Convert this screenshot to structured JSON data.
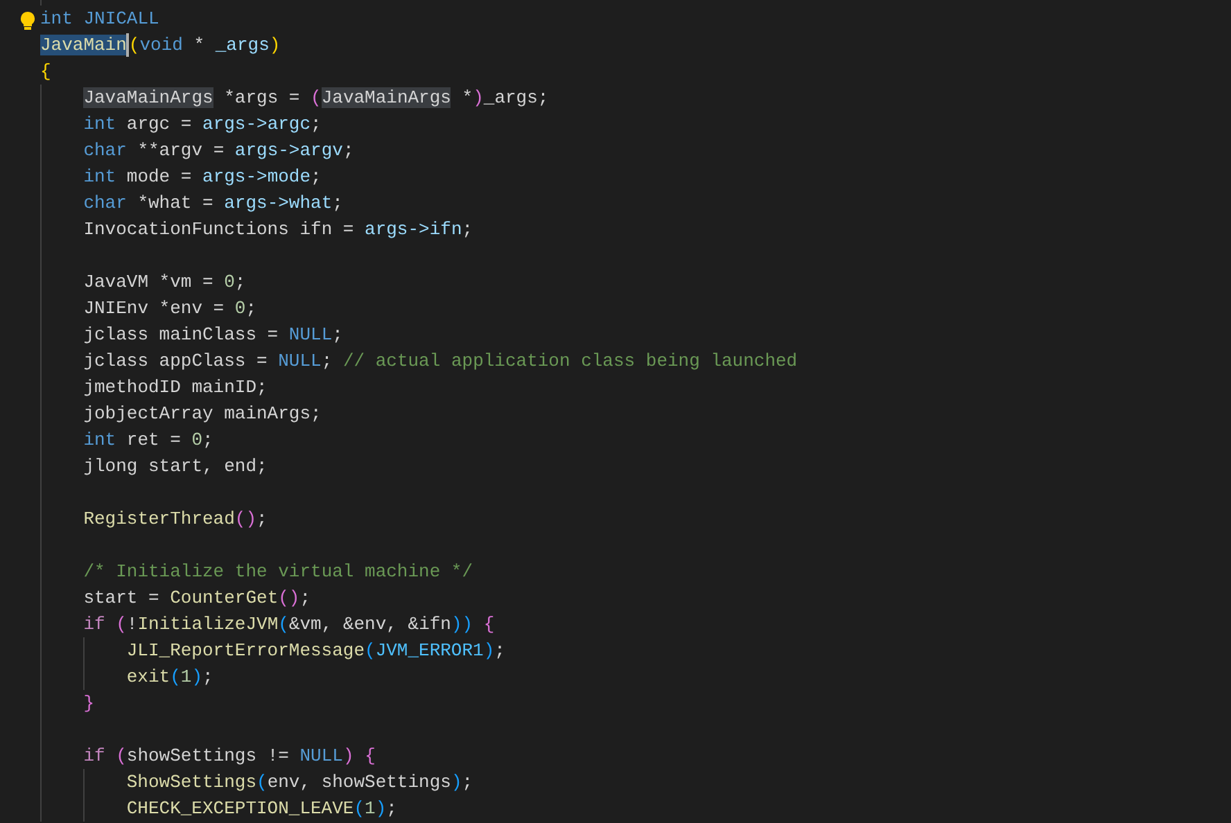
{
  "editor": {
    "lines": [
      {
        "kind": "blank"
      },
      {
        "kind": "code",
        "tokens": [
          {
            "text": "int ",
            "kind": "keyword"
          },
          {
            "text": "JNICALL",
            "kind": "macro"
          }
        ]
      },
      {
        "kind": "code",
        "tokens": [
          {
            "text": "JavaMain",
            "kind": "function",
            "selected": true
          },
          {
            "text": "(",
            "kind": "bracket1"
          },
          {
            "text": "void",
            "kind": "keyword"
          },
          {
            "text": " * ",
            "kind": "plain"
          },
          {
            "text": "_args",
            "kind": "member"
          },
          {
            "text": ")",
            "kind": "bracket1"
          }
        ]
      },
      {
        "kind": "code",
        "tokens": [
          {
            "text": "{",
            "kind": "bracket1"
          }
        ]
      },
      {
        "kind": "code",
        "tokens": [
          {
            "text": "    JavaMainArgs",
            "kind": "plain",
            "highlighted": true
          },
          {
            "text": " *args = ",
            "kind": "plain"
          },
          {
            "text": "(",
            "kind": "bracket2"
          },
          {
            "text": "JavaMainArgs",
            "kind": "plain",
            "highlighted": true
          },
          {
            "text": " *",
            "kind": "plain"
          },
          {
            "text": ")",
            "kind": "bracket2"
          },
          {
            "text": "_args;",
            "kind": "plain"
          }
        ]
      },
      {
        "kind": "code",
        "tokens": [
          {
            "text": "    int",
            "kind": "keyword"
          },
          {
            "text": " argc = ",
            "kind": "plain"
          },
          {
            "text": "args->argc",
            "kind": "member"
          },
          {
            "text": ";",
            "kind": "plain"
          }
        ]
      },
      {
        "kind": "code",
        "tokens": [
          {
            "text": "    char",
            "kind": "keyword"
          },
          {
            "text": " **argv = ",
            "kind": "plain"
          },
          {
            "text": "args->argv",
            "kind": "member"
          },
          {
            "text": ";",
            "kind": "plain"
          }
        ]
      },
      {
        "kind": "code",
        "tokens": [
          {
            "text": "    int",
            "kind": "keyword"
          },
          {
            "text": " mode = ",
            "kind": "plain"
          },
          {
            "text": "args->mode",
            "kind": "member"
          },
          {
            "text": ";",
            "kind": "plain"
          }
        ]
      },
      {
        "kind": "code",
        "tokens": [
          {
            "text": "    char",
            "kind": "keyword"
          },
          {
            "text": " *what = ",
            "kind": "plain"
          },
          {
            "text": "args->what",
            "kind": "member"
          },
          {
            "text": ";",
            "kind": "plain"
          }
        ]
      },
      {
        "kind": "code",
        "tokens": [
          {
            "text": "    InvocationFunctions ifn = ",
            "kind": "plain"
          },
          {
            "text": "args->ifn",
            "kind": "member"
          },
          {
            "text": ";",
            "kind": "plain"
          }
        ]
      },
      {
        "kind": "blank"
      },
      {
        "kind": "code",
        "tokens": [
          {
            "text": "    JavaVM *vm = ",
            "kind": "plain"
          },
          {
            "text": "0",
            "kind": "number"
          },
          {
            "text": ";",
            "kind": "plain"
          }
        ]
      },
      {
        "kind": "code",
        "tokens": [
          {
            "text": "    JNIEnv *env = ",
            "kind": "plain"
          },
          {
            "text": "0",
            "kind": "number"
          },
          {
            "text": ";",
            "kind": "plain"
          }
        ]
      },
      {
        "kind": "code",
        "tokens": [
          {
            "text": "    jclass mainClass = ",
            "kind": "plain"
          },
          {
            "text": "NULL",
            "kind": "macro"
          },
          {
            "text": ";",
            "kind": "plain"
          }
        ]
      },
      {
        "kind": "code",
        "tokens": [
          {
            "text": "    jclass appClass = ",
            "kind": "plain"
          },
          {
            "text": "NULL",
            "kind": "macro"
          },
          {
            "text": "; ",
            "kind": "plain"
          },
          {
            "text": "// actual application class being launched",
            "kind": "comment"
          }
        ]
      },
      {
        "kind": "code",
        "tokens": [
          {
            "text": "    jmethodID mainID;",
            "kind": "plain"
          }
        ]
      },
      {
        "kind": "code",
        "tokens": [
          {
            "text": "    jobjectArray mainArgs;",
            "kind": "plain"
          }
        ]
      },
      {
        "kind": "code",
        "tokens": [
          {
            "text": "    int",
            "kind": "keyword"
          },
          {
            "text": " ret = ",
            "kind": "plain"
          },
          {
            "text": "0",
            "kind": "number"
          },
          {
            "text": ";",
            "kind": "plain"
          }
        ]
      },
      {
        "kind": "code",
        "tokens": [
          {
            "text": "    jlong start, end;",
            "kind": "plain"
          }
        ]
      },
      {
        "kind": "blank"
      },
      {
        "kind": "code",
        "tokens": [
          {
            "text": "    RegisterThread",
            "kind": "function"
          },
          {
            "text": "()",
            "kind": "bracket2"
          },
          {
            "text": ";",
            "kind": "plain"
          }
        ]
      },
      {
        "kind": "blank"
      },
      {
        "kind": "code",
        "tokens": [
          {
            "text": "    /* Initialize the virtual machine */",
            "kind": "comment"
          }
        ]
      },
      {
        "kind": "code",
        "tokens": [
          {
            "text": "    start = ",
            "kind": "plain"
          },
          {
            "text": "CounterGet",
            "kind": "function"
          },
          {
            "text": "()",
            "kind": "bracket2"
          },
          {
            "text": ";",
            "kind": "plain"
          }
        ]
      },
      {
        "kind": "code",
        "tokens": [
          {
            "text": "    if ",
            "kind": "control"
          },
          {
            "text": "(",
            "kind": "bracket2"
          },
          {
            "text": "!",
            "kind": "plain"
          },
          {
            "text": "InitializeJVM",
            "kind": "function"
          },
          {
            "text": "(",
            "kind": "bracket3"
          },
          {
            "text": "&vm, &env, &ifn",
            "kind": "plain"
          },
          {
            "text": "))",
            "kind": "bracket3"
          },
          {
            "text": " {",
            "kind": "bracket2"
          }
        ]
      },
      {
        "kind": "code",
        "tokens": [
          {
            "text": "        JLI_ReportErrorMessage",
            "kind": "function"
          },
          {
            "text": "(",
            "kind": "bracket3"
          },
          {
            "text": "JVM_ERROR1",
            "kind": "constant"
          },
          {
            "text": ")",
            "kind": "bracket3"
          },
          {
            "text": ";",
            "kind": "plain"
          }
        ]
      },
      {
        "kind": "code",
        "tokens": [
          {
            "text": "        exit",
            "kind": "function"
          },
          {
            "text": "(",
            "kind": "bracket3"
          },
          {
            "text": "1",
            "kind": "number"
          },
          {
            "text": ")",
            "kind": "bracket3"
          },
          {
            "text": ";",
            "kind": "plain"
          }
        ]
      },
      {
        "kind": "code",
        "tokens": [
          {
            "text": "    }",
            "kind": "bracket2"
          }
        ]
      },
      {
        "kind": "blank"
      },
      {
        "kind": "code",
        "tokens": [
          {
            "text": "    if ",
            "kind": "control"
          },
          {
            "text": "(",
            "kind": "bracket2"
          },
          {
            "text": "showSettings != ",
            "kind": "plain"
          },
          {
            "text": "NULL",
            "kind": "macro"
          },
          {
            "text": ")",
            "kind": "bracket2"
          },
          {
            "text": " {",
            "kind": "bracket2"
          }
        ]
      },
      {
        "kind": "code",
        "tokens": [
          {
            "text": "        ShowSettings",
            "kind": "function"
          },
          {
            "text": "(",
            "kind": "bracket3"
          },
          {
            "text": "env, showSettings",
            "kind": "plain"
          },
          {
            "text": ")",
            "kind": "bracket3"
          },
          {
            "text": ";",
            "kind": "plain"
          }
        ]
      },
      {
        "kind": "code",
        "tokens": [
          {
            "text": "        CHECK_EXCEPTION_LEAVE",
            "kind": "function"
          },
          {
            "text": "(",
            "kind": "bracket3"
          },
          {
            "text": "1",
            "kind": "number"
          },
          {
            "text": ")",
            "kind": "bracket3"
          },
          {
            "text": ";",
            "kind": "plain"
          }
        ]
      }
    ]
  }
}
